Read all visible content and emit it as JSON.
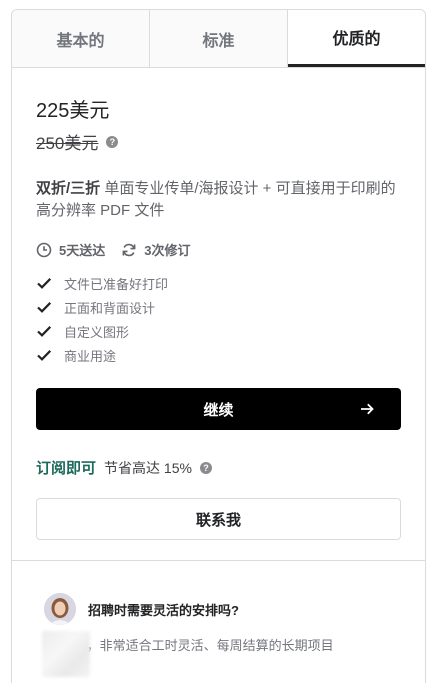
{
  "tabs": [
    {
      "label": "基本的",
      "active": false
    },
    {
      "label": "标准",
      "active": false
    },
    {
      "label": "优质的",
      "active": true
    }
  ],
  "price": "225美元",
  "original_price": "250美元",
  "description": {
    "bold": "双折/三折",
    "text": " 单面专业传单/海报设计 + 可直接用于印刷的高分辨率 PDF 文件"
  },
  "delivery": {
    "icon": "clock-icon",
    "label": "5天送达"
  },
  "revisions": {
    "icon": "refresh-icon",
    "label": "3次修订"
  },
  "features": [
    "文件已准备好打印",
    "正面和背面设计",
    "自定义图形",
    "商业用途"
  ],
  "continue_button": "继续",
  "subscribe": {
    "link": "订阅即可",
    "save": "节省高达 15%"
  },
  "contact_button": "联系我",
  "hire": {
    "title": "招聘时需要灵活的安排吗?",
    "text": "按      计费，非常适合工时灵活、每周结算的长期项目"
  },
  "colors": {
    "accent": "#1d6a5c",
    "primary_button": "#000000",
    "border": "#dadbdd"
  }
}
